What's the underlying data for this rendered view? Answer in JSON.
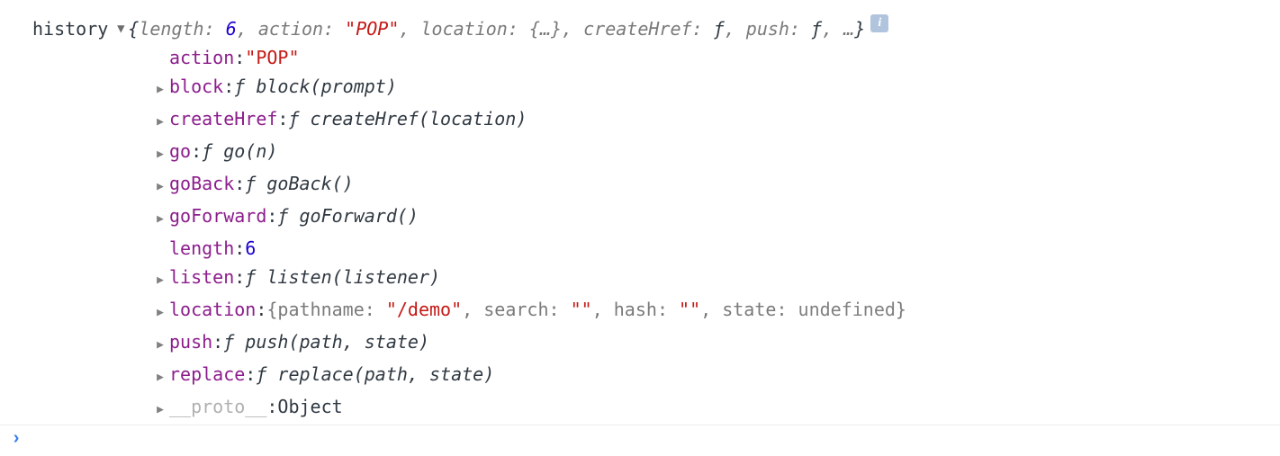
{
  "root": {
    "label": "history",
    "expanded_glyph": "▼",
    "collapsed_glyph": "▶",
    "summary": {
      "open": "{",
      "close": "}",
      "pairs": [
        {
          "k": "length",
          "v": "6",
          "vcls": "v-num"
        },
        {
          "k": "action",
          "v": "\"POP\"",
          "vcls": "v-str"
        },
        {
          "k": "location",
          "v": "{…}",
          "vcls": "dim"
        },
        {
          "k": "createHref",
          "v": "ƒ",
          "vcls": "italic"
        },
        {
          "k": "push",
          "v": "ƒ",
          "vcls": "italic"
        }
      ],
      "ellipsis": ", …"
    },
    "info_glyph": "i"
  },
  "props": [
    {
      "arrow": false,
      "key": "action",
      "kcls": "k-purple",
      "segs": [
        {
          "t": "\"POP\"",
          "cls": "v-str"
        }
      ]
    },
    {
      "arrow": true,
      "key": "block",
      "kcls": "k-purple",
      "segs": [
        {
          "t": "ƒ block(prompt)",
          "cls": "italic"
        }
      ]
    },
    {
      "arrow": true,
      "key": "createHref",
      "kcls": "k-purple",
      "segs": [
        {
          "t": "ƒ createHref(location)",
          "cls": "italic"
        }
      ]
    },
    {
      "arrow": true,
      "key": "go",
      "kcls": "k-purple",
      "segs": [
        {
          "t": "ƒ go(n)",
          "cls": "italic"
        }
      ]
    },
    {
      "arrow": true,
      "key": "goBack",
      "kcls": "k-purple",
      "segs": [
        {
          "t": "ƒ goBack()",
          "cls": "italic"
        }
      ]
    },
    {
      "arrow": true,
      "key": "goForward",
      "kcls": "k-purple",
      "segs": [
        {
          "t": "ƒ goForward()",
          "cls": "italic"
        }
      ]
    },
    {
      "arrow": false,
      "key": "length",
      "kcls": "k-purple",
      "segs": [
        {
          "t": "6",
          "cls": "v-num"
        }
      ]
    },
    {
      "arrow": true,
      "key": "listen",
      "kcls": "k-purple",
      "segs": [
        {
          "t": "ƒ listen(listener)",
          "cls": "italic"
        }
      ]
    },
    {
      "arrow": true,
      "key": "location",
      "kcls": "k-purple",
      "segs": [
        {
          "t": "{",
          "cls": "dim"
        },
        {
          "t": "pathname",
          "cls": "dim"
        },
        {
          "t": ": ",
          "cls": "dim"
        },
        {
          "t": "\"/demo\"",
          "cls": "v-str"
        },
        {
          "t": ", ",
          "cls": "dim"
        },
        {
          "t": "search",
          "cls": "dim"
        },
        {
          "t": ": ",
          "cls": "dim"
        },
        {
          "t": "\"\"",
          "cls": "v-str"
        },
        {
          "t": ", ",
          "cls": "dim"
        },
        {
          "t": "hash",
          "cls": "dim"
        },
        {
          "t": ": ",
          "cls": "dim"
        },
        {
          "t": "\"\"",
          "cls": "v-str"
        },
        {
          "t": ", ",
          "cls": "dim"
        },
        {
          "t": "state",
          "cls": "dim"
        },
        {
          "t": ": ",
          "cls": "dim"
        },
        {
          "t": "undefined",
          "cls": "v-undef"
        },
        {
          "t": "}",
          "cls": "dim"
        }
      ]
    },
    {
      "arrow": true,
      "key": "push",
      "kcls": "k-purple",
      "segs": [
        {
          "t": "ƒ push(path, state)",
          "cls": "italic"
        }
      ]
    },
    {
      "arrow": true,
      "key": "replace",
      "kcls": "k-purple",
      "segs": [
        {
          "t": "ƒ replace(path, state)",
          "cls": "italic"
        }
      ]
    },
    {
      "arrow": true,
      "key": "__proto__",
      "kcls": "k-faded",
      "segs": [
        {
          "t": "Object",
          "cls": "v-func"
        }
      ]
    }
  ],
  "prompt": "›"
}
